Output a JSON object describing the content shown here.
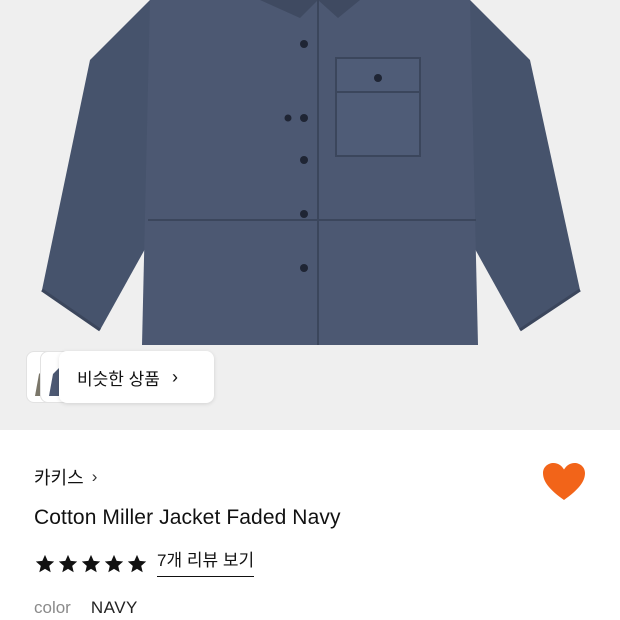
{
  "similar": {
    "label": "비슷한 상품",
    "chevron": "›"
  },
  "product": {
    "brand": "카키스",
    "brand_chevron": "›",
    "title": "Cotton Miller Jacket Faded Navy",
    "rating_stars": 5,
    "review_link": "7개 리뷰 보기",
    "color_label": "color",
    "color_value": "NAVY"
  },
  "colors": {
    "heart": "#f26419",
    "jacket": "#4a5670",
    "hero_bg": "#efefef"
  },
  "icons": {
    "heart": "heart-icon",
    "star": "star-icon",
    "chevron": "chevron-right-icon"
  }
}
